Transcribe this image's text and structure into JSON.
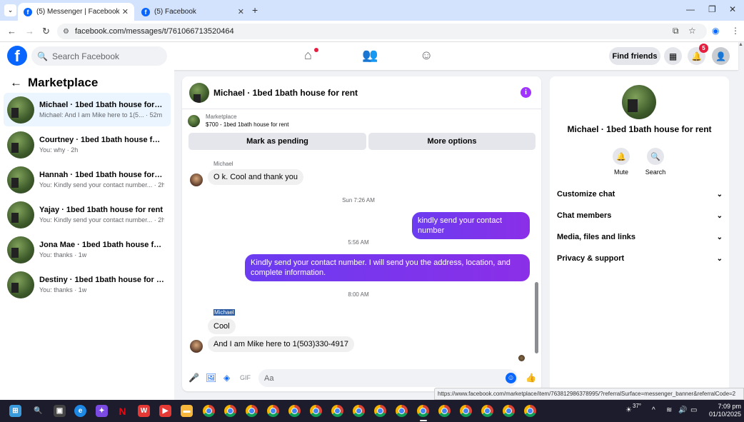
{
  "browser": {
    "tabs": [
      {
        "title": "(5) Messenger | Facebook"
      },
      {
        "title": "(5) Facebook"
      }
    ],
    "url": "facebook.com/messages/t/761066713520464"
  },
  "header": {
    "search_placeholder": "Search Facebook",
    "find_friends": "Find friends",
    "notification_count": "5"
  },
  "sidebar": {
    "title": "Marketplace",
    "conversations": [
      {
        "name": "Michael · 1bed 1bath house for rent",
        "preview": "Michael: And I am Mike here to 1(5...  · 52m"
      },
      {
        "name": "Courtney · 1bed 1bath house for re...",
        "preview": "You: why · 2h"
      },
      {
        "name": "Hannah · 1bed 1bath house for rent",
        "preview": "You: Kindly send your contact number... · 2h"
      },
      {
        "name": "Yajay · 1bed 1bath house for rent",
        "preview": "You: Kindly send your contact number... · 2h"
      },
      {
        "name": "Jona Mae · 1bed 1bath house for r...",
        "preview": "You: thanks · 1w"
      },
      {
        "name": "Destiny · 1bed 1bath house for rent",
        "preview": "You: thanks · 1w"
      }
    ]
  },
  "chat": {
    "title": "Michael · 1bed 1bath house for rent",
    "marketplace_label": "Marketplace",
    "listing": "$700 - 1bed 1bath house for rent",
    "mark_pending": "Mark as pending",
    "more_options": "More options",
    "sender1": "Michael",
    "msg1": "O k. Cool and thank you",
    "time1": "Sun 7:26 AM",
    "out1": "kindly send your contact number",
    "time2": "5:56 AM",
    "out2": "Kindly send your contact number. I will send you the address, location, and complete information.",
    "time3": "8:00 AM",
    "sender2": "Michael",
    "msg2": "Cool",
    "msg3": "And I am Mike here to 1(503)330-4917",
    "composer_placeholder": "Aa"
  },
  "details": {
    "name": "Michael · 1bed 1bath house for rent",
    "mute": "Mute",
    "search": "Search",
    "sections": [
      "Customize chat",
      "Chat members",
      "Media, files and links",
      "Privacy & support"
    ]
  },
  "status_url": "https://www.facebook.com/marketplace/item/763812986378995/?referralSurface=messenger_banner&referralCode=2",
  "taskbar": {
    "temperature": "37°",
    "time": "7:09 pm",
    "date": "01/10/2025"
  },
  "colors": {
    "brand": "#0866ff",
    "outgoing_bubble": "#7b2ff7",
    "badge": "#e41e3f"
  }
}
